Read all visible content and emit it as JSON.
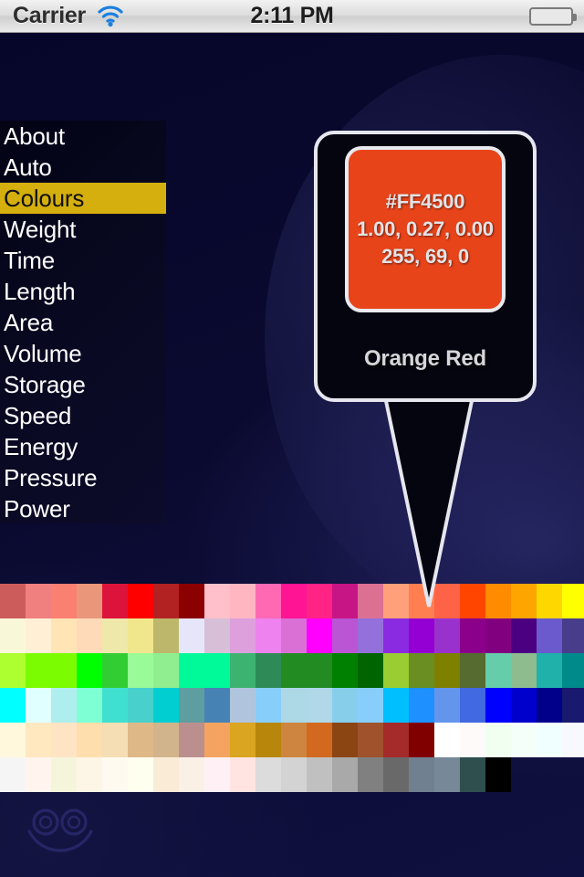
{
  "statusbar": {
    "carrier": "Carrier",
    "time": "2:11 PM",
    "wifi_icon": "wifi-icon",
    "battery_icon": "battery-icon"
  },
  "menu": {
    "items": [
      {
        "label": "About",
        "selected": false
      },
      {
        "label": "Auto",
        "selected": false
      },
      {
        "label": "Colours",
        "selected": true
      },
      {
        "label": "Weight",
        "selected": false
      },
      {
        "label": "Time",
        "selected": false
      },
      {
        "label": "Length",
        "selected": false
      },
      {
        "label": "Area",
        "selected": false
      },
      {
        "label": "Volume",
        "selected": false
      },
      {
        "label": "Storage",
        "selected": false
      },
      {
        "label": "Speed",
        "selected": false
      },
      {
        "label": "Energy",
        "selected": false
      },
      {
        "label": "Pressure",
        "selected": false
      },
      {
        "label": "Power",
        "selected": false
      }
    ],
    "highlight_color": "#d4af0e",
    "highlight_text_color": "#111111"
  },
  "callout": {
    "hex": "#FF4500",
    "normalized": "1.00, 0.27, 0.00",
    "rgb255": "255, 69, 0",
    "name": "Orange Red",
    "swatch_color": "#e8441a",
    "border_color": "#e6e6ef"
  },
  "colour_grid": {
    "columns": 23,
    "rows": [
      [
        "#cc5c5c",
        "#f08080",
        "#fa8072",
        "#e9967a",
        "#dc143c",
        "#ff0000",
        "#b22222",
        "#8b0000",
        "#ffc0cb",
        "#ffb6c1",
        "#ff69b4",
        "#ff1493",
        "#ff2386",
        "#c71585",
        "#db7093",
        "#ffa07a",
        "#ff7f50",
        "#ff6347",
        "#ff4500",
        "#ff8c00",
        "#ffa500",
        "#ffd700",
        "#ffff00"
      ],
      [
        "#f8f8d8",
        "#ffefd5",
        "#ffe4b5",
        "#ffdab9",
        "#eee8aa",
        "#f0e68c",
        "#bdb76b",
        "#e6e6fa",
        "#d8bfd8",
        "#dda0dd",
        "#ee82ee",
        "#da70d6",
        "#ff00ff",
        "#ba55d3",
        "#9370db",
        "#8a2be2",
        "#9400d3",
        "#9932cc",
        "#8b008b",
        "#800080",
        "#4b0082",
        "#6a5acd",
        "#483d8b"
      ],
      [
        "#adff2f",
        "#7cfc00",
        "#7cfc00",
        "#00ff00",
        "#32cd32",
        "#98fb98",
        "#90ee90",
        "#00fa9a",
        "#00fa9a",
        "#3cb371",
        "#2e8b57",
        "#228b22",
        "#228b22",
        "#008000",
        "#006400",
        "#9acd32",
        "#6b8e23",
        "#808000",
        "#556b2f",
        "#66cdaa",
        "#8fbc8f",
        "#20b2aa",
        "#008b8b"
      ],
      [
        "#00ffff",
        "#e0ffff",
        "#afeeee",
        "#7fffd4",
        "#40e0d0",
        "#48d1cc",
        "#00ced1",
        "#5f9ea0",
        "#4682b4",
        "#b0c4de",
        "#87cefa",
        "#add8e6",
        "#b0d8e8",
        "#87ceeb",
        "#87cefa",
        "#00bfff",
        "#1e90ff",
        "#6495ed",
        "#4169e1",
        "#0000ff",
        "#0000cd",
        "#00008b",
        "#191970"
      ],
      [
        "#fff8dc",
        "#ffe8c0",
        "#ffe4c4",
        "#ffdead",
        "#f5deb3",
        "#deb887",
        "#d2b48c",
        "#bc8f8f",
        "#f4a460",
        "#daa520",
        "#b8860b",
        "#cd853f",
        "#d2691e",
        "#8b4513",
        "#a0522d",
        "#a52a2a",
        "#800000",
        "#ffffff",
        "#fffafa",
        "#f0fff0",
        "#f5fffa",
        "#f0ffff",
        "#f8f8ff"
      ],
      [
        "#f5f5f5",
        "#fff5ee",
        "#f5f5dc",
        "#fdf5e6",
        "#fffaf0",
        "#fffff0",
        "#faebd7",
        "#faf0e6",
        "#fff0f5",
        "#ffe4e1",
        "#dcdcdc",
        "#d3d3d3",
        "#c0c0c0",
        "#a9a9a9",
        "#808080",
        "#696969",
        "#708090",
        "#778899",
        "#2f4f4f",
        "#000000"
      ]
    ],
    "selected_cell": {
      "row": 0,
      "col": 18,
      "hex": "#ff4500"
    }
  },
  "decoration": {
    "smiley_icon": "smiley-face-icon"
  }
}
